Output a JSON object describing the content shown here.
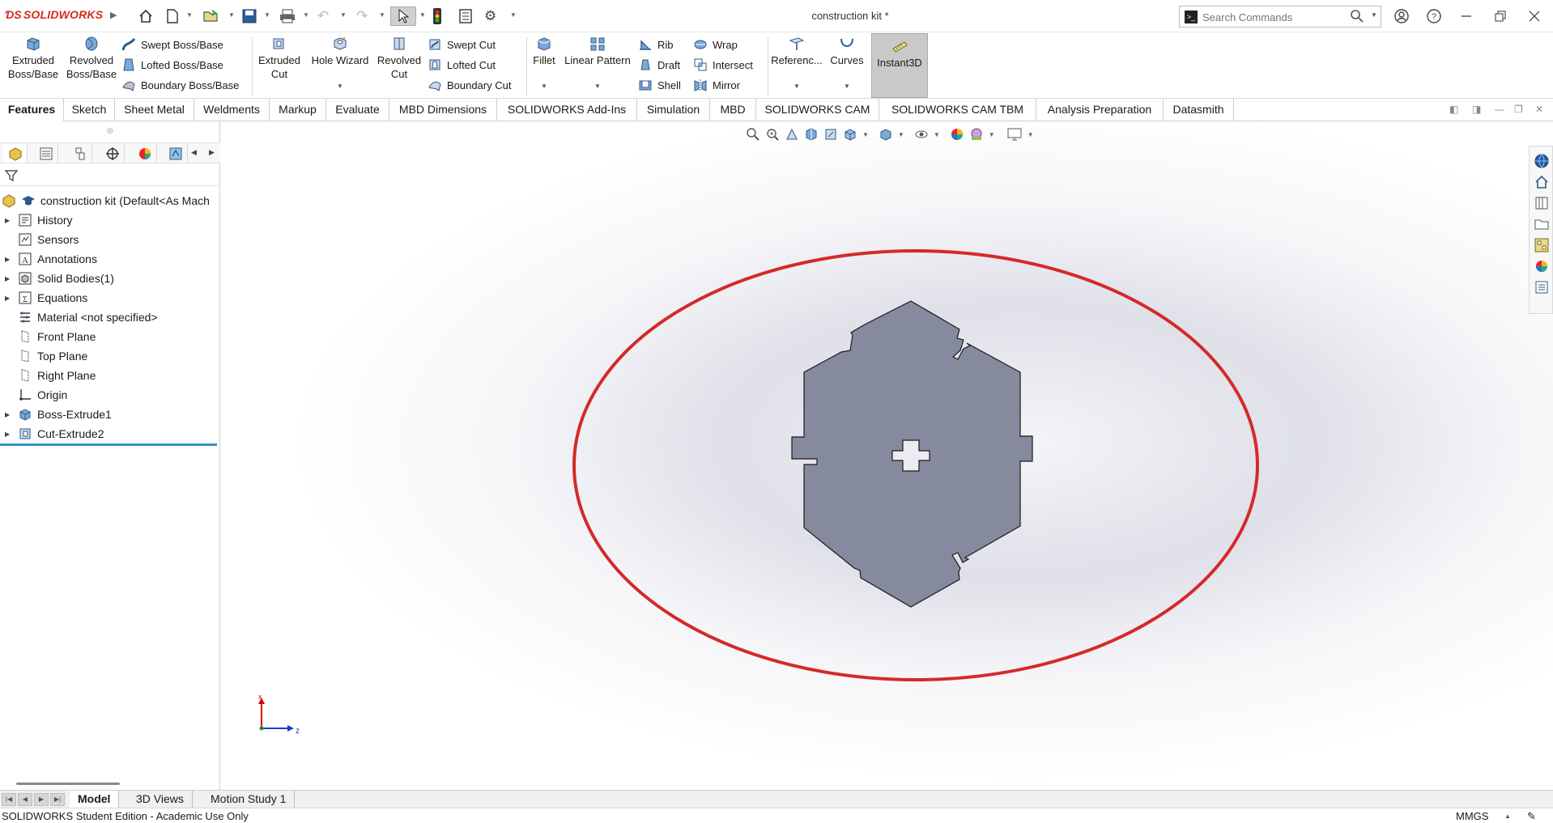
{
  "app": {
    "logo_text": "SOLIDWORKS",
    "document_title": "construction kit *"
  },
  "search": {
    "placeholder": "Search Commands"
  },
  "command_manager": {
    "extruded_boss": "Extruded Boss/Base",
    "revolved_boss": "Revolved Boss/Base",
    "swept_boss": "Swept Boss/Base",
    "lofted_boss": "Lofted Boss/Base",
    "boundary_boss": "Boundary Boss/Base",
    "extruded_cut": "Extruded Cut",
    "hole_wizard": "Hole Wizard",
    "revolved_cut": "Revolved Cut",
    "swept_cut": "Swept Cut",
    "lofted_cut": "Lofted Cut",
    "boundary_cut": "Boundary Cut",
    "fillet": "Fillet",
    "linear_pattern": "Linear Pattern",
    "rib": "Rib",
    "draft": "Draft",
    "shell": "Shell",
    "wrap": "Wrap",
    "intersect": "Intersect",
    "mirror": "Mirror",
    "reference": "Referenc...",
    "curves": "Curves",
    "instant3d": "Instant3D"
  },
  "tabs": [
    {
      "label": "Features"
    },
    {
      "label": "Sketch"
    },
    {
      "label": "Sheet Metal"
    },
    {
      "label": "Weldments"
    },
    {
      "label": "Markup"
    },
    {
      "label": "Evaluate"
    },
    {
      "label": "MBD Dimensions"
    },
    {
      "label": "SOLIDWORKS Add-Ins"
    },
    {
      "label": "Simulation"
    },
    {
      "label": "MBD"
    },
    {
      "label": "SOLIDWORKS CAM"
    },
    {
      "label": "SOLIDWORKS CAM TBM"
    },
    {
      "label": "Analysis Preparation"
    },
    {
      "label": "Datasmith"
    }
  ],
  "tree": {
    "root": "construction kit  (Default<As Mach",
    "items": [
      {
        "label": "History"
      },
      {
        "label": "Sensors"
      },
      {
        "label": "Annotations"
      },
      {
        "label": "Solid Bodies(1)"
      },
      {
        "label": "Equations"
      },
      {
        "label": "Material <not specified>"
      },
      {
        "label": "Front Plane"
      },
      {
        "label": "Top Plane"
      },
      {
        "label": "Right Plane"
      },
      {
        "label": "Origin"
      },
      {
        "label": "Boss-Extrude1"
      },
      {
        "label": "Cut-Extrude2"
      }
    ]
  },
  "triad": {
    "x_label": "x",
    "z_label": "z"
  },
  "bottom_tabs": [
    {
      "label": "Model"
    },
    {
      "label": "3D Views"
    },
    {
      "label": "Motion Study 1"
    }
  ],
  "status": {
    "text": "SOLIDWORKS Student Edition - Academic Use Only",
    "units": "MMGS"
  },
  "colors": {
    "accent": "#d52b1e",
    "part_fill": "#858a9e",
    "annotation_ellipse": "#d42a2a",
    "rollback_bar": "#3a8fc7"
  }
}
